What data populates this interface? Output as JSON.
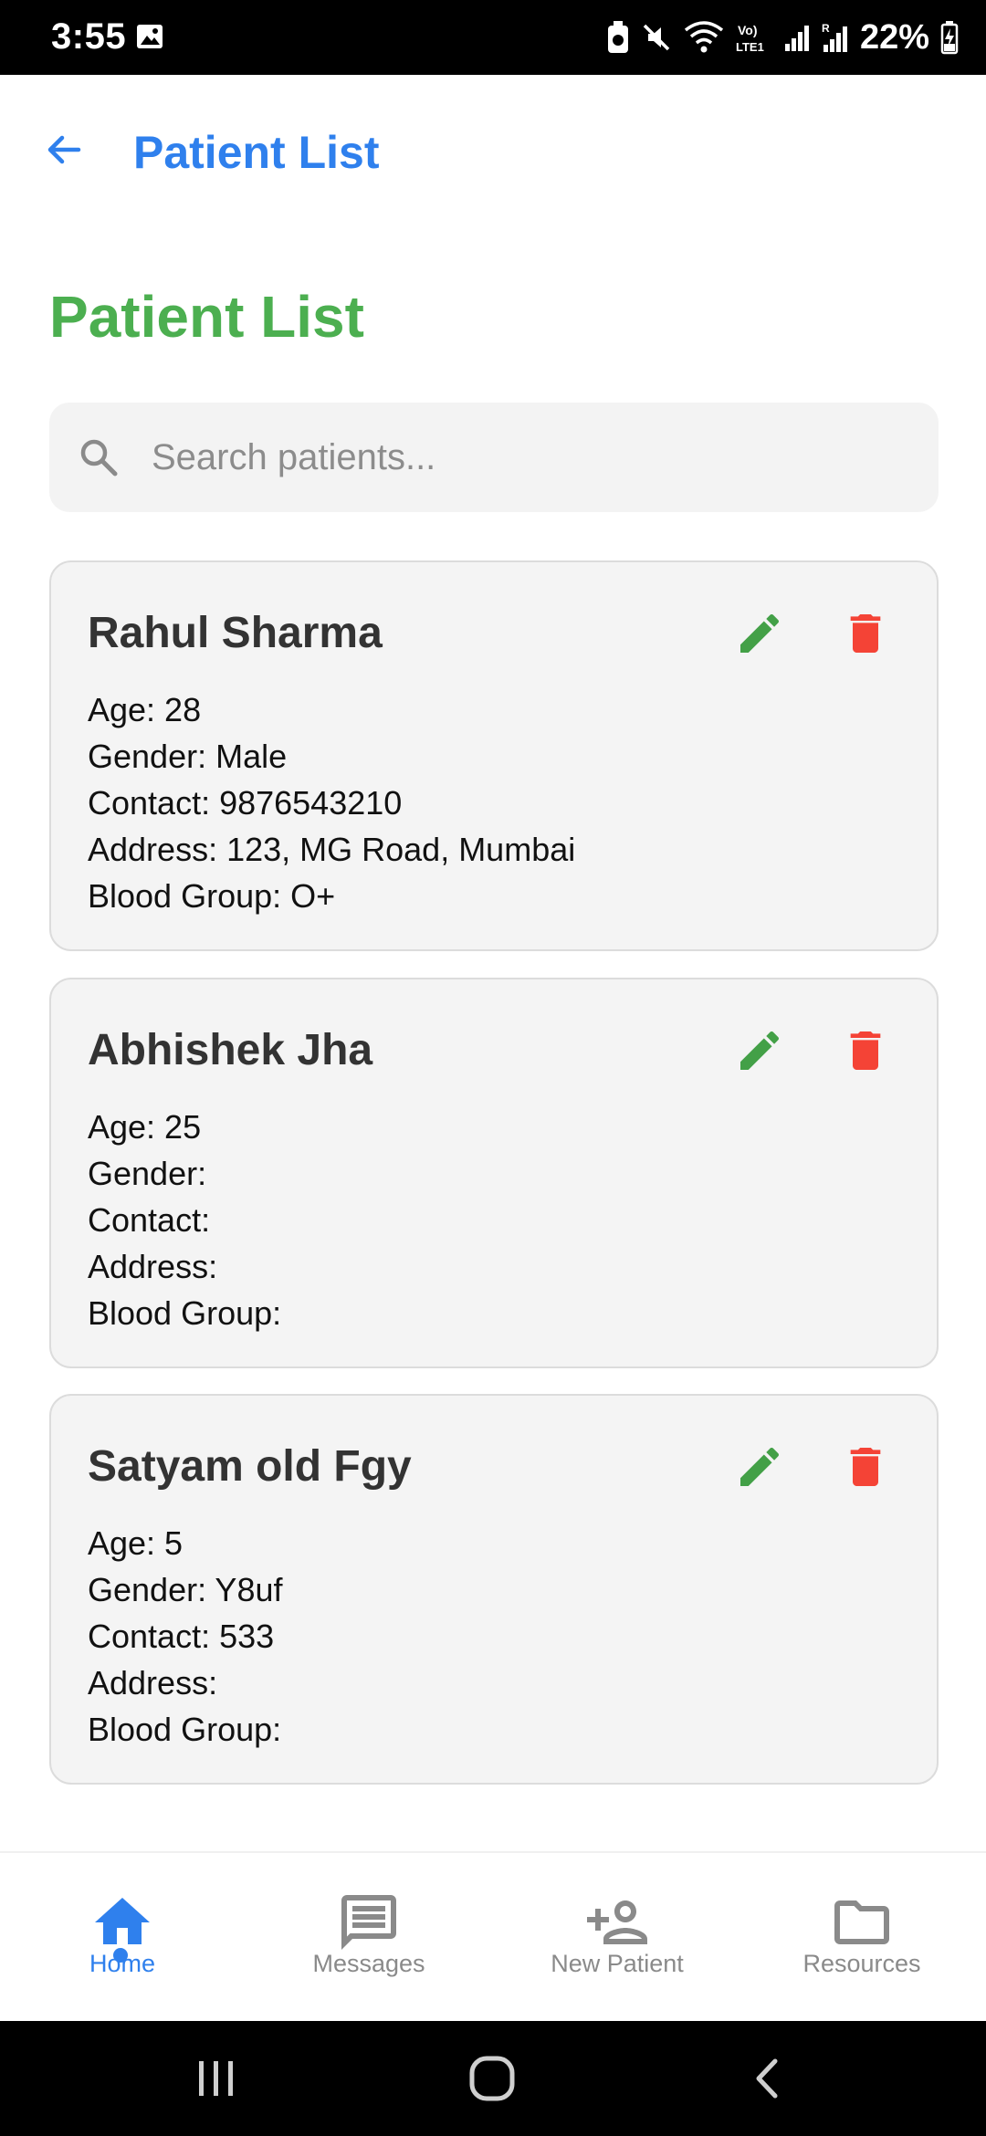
{
  "status_bar": {
    "time": "3:55",
    "battery": "22%"
  },
  "app_bar": {
    "title": "Patient List",
    "back_icon": "arrow-left-icon"
  },
  "heading": "Patient List",
  "search": {
    "placeholder": "Search patients...",
    "value": ""
  },
  "patients": [
    {
      "name": "Rahul Sharma",
      "age": "Age: 28",
      "gender": "Gender: Male",
      "contact": "Contact: 9876543210",
      "address": "Address: 123, MG Road, Mumbai",
      "blood_group": "Blood Group: O+"
    },
    {
      "name": "Abhishek Jha",
      "age": "Age: 25",
      "gender": "Gender:",
      "contact": "Contact:",
      "address": "Address:",
      "blood_group": "Blood Group:"
    },
    {
      "name": "Satyam old Fgy",
      "age": "Age: 5",
      "gender": "Gender: Y8uf",
      "contact": "Contact: 533",
      "address": "Address:",
      "blood_group": "Blood Group:"
    }
  ],
  "bottom_nav": {
    "items": [
      {
        "label": "Home",
        "icon": "home-icon",
        "active": true
      },
      {
        "label": "Messages",
        "icon": "message-icon",
        "active": false
      },
      {
        "label": "New Patient",
        "icon": "add-person-icon",
        "active": false
      },
      {
        "label": "Resources",
        "icon": "folder-icon",
        "active": false
      }
    ]
  },
  "colors": {
    "primary_blue": "#2f80ed",
    "heading_green": "#4caf50",
    "edit_green": "#43a047",
    "delete_red": "#f44336",
    "card_bg": "#f4f4f4"
  }
}
